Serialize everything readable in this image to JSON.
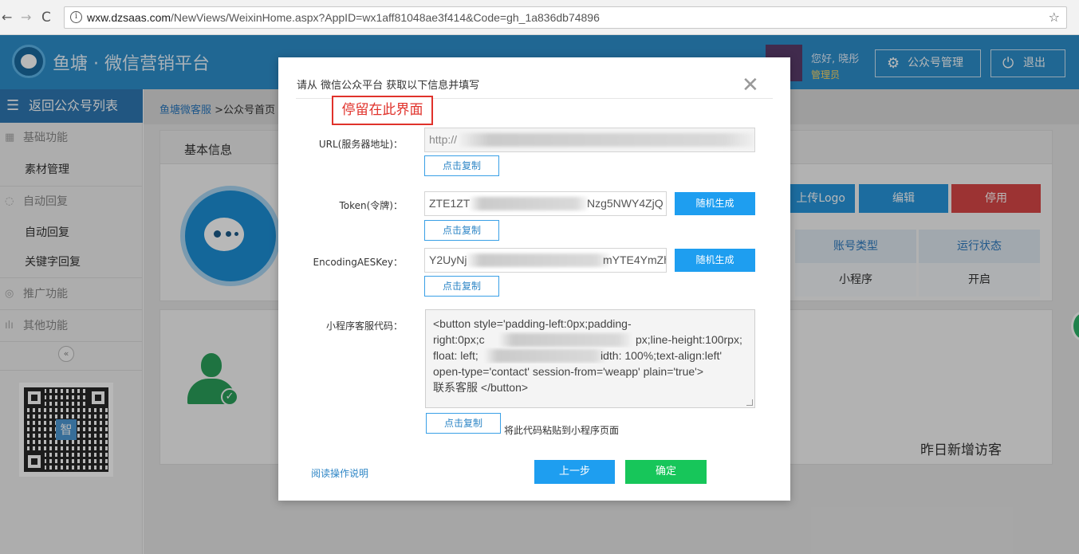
{
  "browser": {
    "url_host": "wxw.dzsaas.com",
    "url_path": "/NewViews/WeixinHome.aspx?AppID=wx1aff81048ae3f414&Code=gh_1a836db74896"
  },
  "header": {
    "title": "鱼塘 · 微信营销平台",
    "greeting": "您好, 晓彤",
    "role": "管理员",
    "manage_label": "公众号管理",
    "exit_label": "退出"
  },
  "sidebar": {
    "back_label": "返回公众号列表",
    "groups": [
      {
        "label": "基础功能",
        "items": [
          "素材管理"
        ]
      },
      {
        "label": "自动回复",
        "items": [
          "自动回复",
          "关键字回复"
        ]
      },
      {
        "label": "推广功能",
        "items": []
      },
      {
        "label": "其他功能",
        "items": []
      }
    ],
    "collapse_glyph": "«",
    "qr_center": "智"
  },
  "main": {
    "breadcrumb_link": "鱼塘微客服",
    "breadcrumb_rest": " >公众号首页",
    "panel_title": "基本信息",
    "upload_logo_label": "上传Logo",
    "edit_label": "编辑",
    "disable_label": "停用",
    "table_headers": [
      "账号类型",
      "运行状态"
    ],
    "table_values": [
      "小程序",
      "开启"
    ],
    "visitors_label": "昨日新增访客"
  },
  "modal": {
    "title": "请从 微信公众平台 获取以下信息并填写",
    "note": "停留在此界面",
    "url_label": "URL(服务器地址)：",
    "url_value": "http://",
    "token_label": "Token(令牌)：",
    "token_value_start": "ZTE1ZT",
    "token_value_end": "Nzg5NWY4ZjQ",
    "aes_label": "EncodingAESKey：",
    "aes_value_start": "Y2UyNj",
    "aes_value_end": "mYTE4YmZh",
    "code_label": "小程序客服代码：",
    "code_lines": [
      "<button style='padding-left:0px;padding-",
      "right:0px;c",
      "px;line-height:100rpx;",
      "float: left;",
      "idth: 100%;text-align:left'",
      "open-type='contact' session-from='weapp' plain='true'>",
      "联系客服 </button>"
    ],
    "copy_label": "点击复制",
    "generate_label": "随机生成",
    "hint": "将此代码粘贴到小程序页面",
    "read_doc": "阅读操作说明",
    "prev_label": "上一步",
    "ok_label": "确定"
  }
}
